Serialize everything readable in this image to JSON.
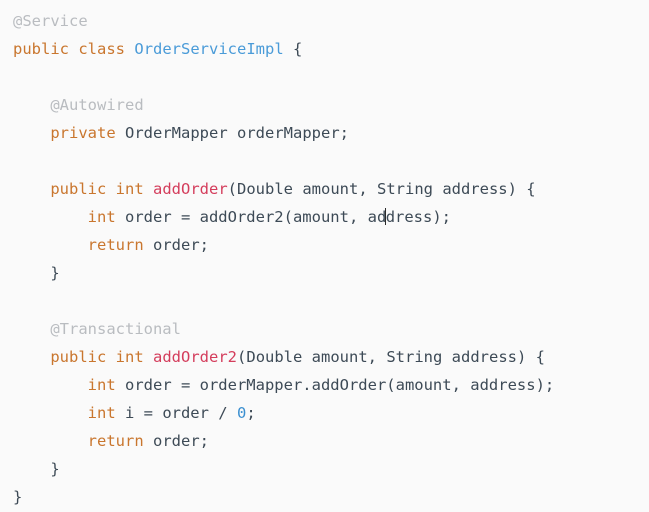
{
  "editor": {
    "language": "Java",
    "background_color": "#fafafa",
    "caret": {
      "line_number": 8,
      "inside_token": "address",
      "after_characters": "ad"
    },
    "colors": {
      "keyword": "#c9762e",
      "class_name": "#4a9bd8",
      "method_name": "#d43d5c",
      "annotation": "#b9bcc0",
      "number": "#3a8fd0",
      "plain_text": "#3d4a56",
      "background": "#fafafa"
    },
    "lines": [
      {
        "n": 1,
        "text": "@Service",
        "tokens": [
          {
            "t": "@Service",
            "c": "anno"
          }
        ]
      },
      {
        "n": 2,
        "text": "public class OrderServiceImpl {",
        "tokens": [
          {
            "t": "public",
            "c": "kw"
          },
          {
            "t": " ",
            "c": "plain"
          },
          {
            "t": "class",
            "c": "kw"
          },
          {
            "t": " ",
            "c": "plain"
          },
          {
            "t": "OrderServiceImpl",
            "c": "cls"
          },
          {
            "t": " {",
            "c": "punc"
          }
        ]
      },
      {
        "n": 3,
        "text": "",
        "tokens": []
      },
      {
        "n": 4,
        "text": "    @Autowired",
        "tokens": [
          {
            "t": "    ",
            "c": "plain"
          },
          {
            "t": "@Autowired",
            "c": "anno"
          }
        ]
      },
      {
        "n": 5,
        "text": "    private OrderMapper orderMapper;",
        "tokens": [
          {
            "t": "    ",
            "c": "plain"
          },
          {
            "t": "private",
            "c": "kw"
          },
          {
            "t": " ",
            "c": "plain"
          },
          {
            "t": "OrderMapper",
            "c": "type"
          },
          {
            "t": " ",
            "c": "plain"
          },
          {
            "t": "orderMapper;",
            "c": "plain"
          }
        ]
      },
      {
        "n": 6,
        "text": "",
        "tokens": []
      },
      {
        "n": 7,
        "text": "    public int addOrder(Double amount, String address) {",
        "tokens": [
          {
            "t": "    ",
            "c": "plain"
          },
          {
            "t": "public",
            "c": "kw"
          },
          {
            "t": " ",
            "c": "plain"
          },
          {
            "t": "int",
            "c": "kw"
          },
          {
            "t": " ",
            "c": "plain"
          },
          {
            "t": "addOrder",
            "c": "method"
          },
          {
            "t": "(",
            "c": "punc"
          },
          {
            "t": "Double amount, String address",
            "c": "type"
          },
          {
            "t": ") {",
            "c": "punc"
          }
        ]
      },
      {
        "n": 8,
        "text": "        int order = addOrder2(amount, address);",
        "tokens": [
          {
            "t": "        ",
            "c": "plain"
          },
          {
            "t": "int",
            "c": "kw"
          },
          {
            "t": " order = addOrder2(amount, ad",
            "c": "plain"
          },
          {
            "t": "CARET",
            "c": "caret"
          },
          {
            "t": "dress);",
            "c": "plain"
          }
        ]
      },
      {
        "n": 9,
        "text": "        return order;",
        "tokens": [
          {
            "t": "        ",
            "c": "plain"
          },
          {
            "t": "return",
            "c": "kw"
          },
          {
            "t": " order;",
            "c": "plain"
          }
        ]
      },
      {
        "n": 10,
        "text": "    }",
        "tokens": [
          {
            "t": "    }",
            "c": "punc"
          }
        ]
      },
      {
        "n": 11,
        "text": "",
        "tokens": []
      },
      {
        "n": 12,
        "text": "    @Transactional",
        "tokens": [
          {
            "t": "    ",
            "c": "plain"
          },
          {
            "t": "@Transactional",
            "c": "anno"
          }
        ]
      },
      {
        "n": 13,
        "text": "    public int addOrder2(Double amount, String address) {",
        "tokens": [
          {
            "t": "    ",
            "c": "plain"
          },
          {
            "t": "public",
            "c": "kw"
          },
          {
            "t": " ",
            "c": "plain"
          },
          {
            "t": "int",
            "c": "kw"
          },
          {
            "t": " ",
            "c": "plain"
          },
          {
            "t": "addOrder2",
            "c": "method"
          },
          {
            "t": "(",
            "c": "punc"
          },
          {
            "t": "Double amount, String address",
            "c": "type"
          },
          {
            "t": ") {",
            "c": "punc"
          }
        ]
      },
      {
        "n": 14,
        "text": "        int order = orderMapper.addOrder(amount, address);",
        "tokens": [
          {
            "t": "        ",
            "c": "plain"
          },
          {
            "t": "int",
            "c": "kw"
          },
          {
            "t": " order = orderMapper.addOrder(amount, address);",
            "c": "plain"
          }
        ]
      },
      {
        "n": 15,
        "text": "        int i = order / 0;",
        "tokens": [
          {
            "t": "        ",
            "c": "plain"
          },
          {
            "t": "int",
            "c": "kw"
          },
          {
            "t": " i = order / ",
            "c": "plain"
          },
          {
            "t": "0",
            "c": "num"
          },
          {
            "t": ";",
            "c": "plain"
          }
        ]
      },
      {
        "n": 16,
        "text": "        return order;",
        "tokens": [
          {
            "t": "        ",
            "c": "plain"
          },
          {
            "t": "return",
            "c": "kw"
          },
          {
            "t": " order;",
            "c": "plain"
          }
        ]
      },
      {
        "n": 17,
        "text": "    }",
        "tokens": [
          {
            "t": "    }",
            "c": "punc"
          }
        ]
      },
      {
        "n": 18,
        "text": "}",
        "tokens": [
          {
            "t": "}",
            "c": "punc"
          }
        ]
      }
    ]
  }
}
